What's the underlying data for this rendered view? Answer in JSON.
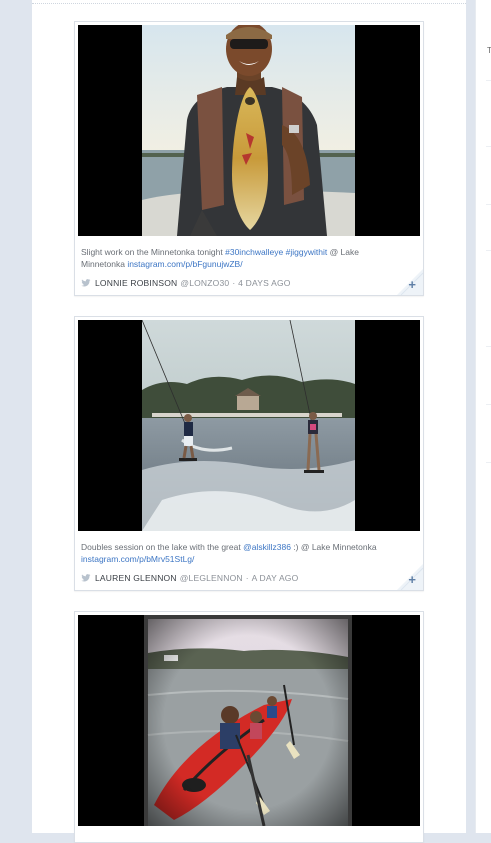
{
  "posts": [
    {
      "caption_before": "Slight work on the Minnetonka tonight ",
      "hashtags": [
        "#30inchwalleye",
        "#jiggywithit"
      ],
      "caption_after": " @ Lake Minnetonka ",
      "link": "instagram.com/p/bFgunujwZB/",
      "author": "Lonnie Robinson",
      "handle": "@LONZO30",
      "time": "4 DAYS AGO",
      "photo": "man-holding-walleye-fish-on-boat"
    },
    {
      "caption_before": "Doubles session on the lake with the great ",
      "mention": "@alskillz386",
      "caption_after": " :) @ Lake Minnetonka ",
      "link": "instagram.com/p/bMrv51StLg/",
      "author": "Lauren Glennon",
      "handle": "@LEGLENNON",
      "time": "A DAY AGO",
      "photo": "two-wakeboarders-on-lake"
    },
    {
      "photo": "family-in-red-kayak-on-lake"
    }
  ],
  "separator": "·",
  "colors": {
    "link": "#3d76c4",
    "background": "#dfe5ee",
    "card_border": "#dadfe6",
    "plus": "#5f7fa6"
  },
  "icons": [
    "twitter-bird-icon",
    "plus-icon"
  ]
}
